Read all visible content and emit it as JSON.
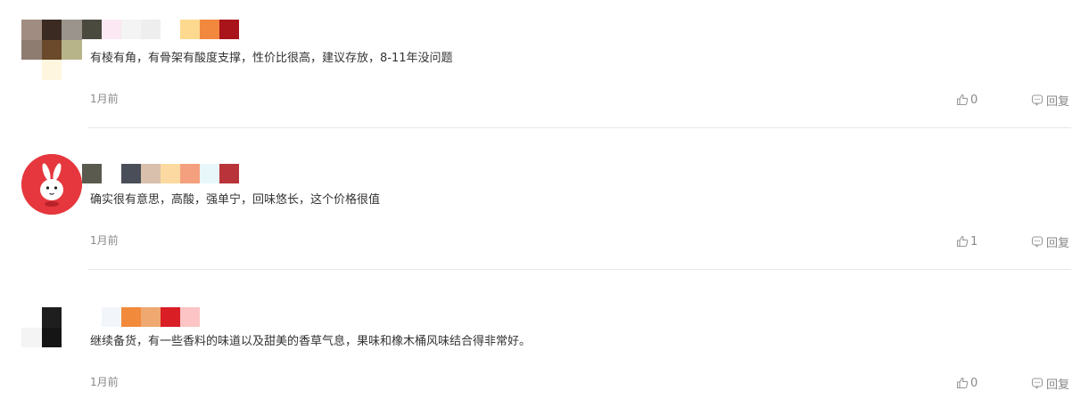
{
  "comments": [
    {
      "text": "有棱有角，有骨架有酸度支撑，性价比很高，建议存放，8-11年没问题",
      "time": "1月前",
      "likes": "0",
      "reply_label": "回复",
      "avatar_type": "pixelated",
      "avatar_colors": [
        "#a08c80",
        "#3a2a22",
        "#9a948c",
        "#8e7c70",
        "#6a4a2a",
        "#b8b48a",
        "#ffffff",
        "#fff6e0",
        "#ffffff"
      ],
      "name_colors": [
        "#4a4a3e",
        "#fbe8f2",
        "#f4f4f4",
        "#eeeeee",
        "#ffffff",
        "#fcd98e",
        "#f2873e",
        "#a8141a"
      ]
    },
    {
      "text": "确实很有意思，高酸，强单宁，回味悠长，这个价格很值",
      "time": "1月前",
      "likes": "1",
      "reply_label": "回复",
      "avatar_type": "bunny-icon",
      "avatar_colors": [
        "#e5373d",
        "#ffffff"
      ],
      "name_colors": [
        "#5a5a4e",
        "#ffffff",
        "#4a4e58",
        "#d8c0ac",
        "#fcd9a0",
        "#f4a07e",
        "#e8f8fa",
        "#b8343a"
      ]
    },
    {
      "text": "继续备货，有一些香料的味道以及甜美的香草气息，果味和橡木桶风味结合得非常好。",
      "time": "1月前",
      "likes": "0",
      "reply_label": "回复",
      "avatar_type": "pixelated",
      "avatar_colors": [
        "#ffffff",
        "#1e1e1e",
        "#ffffff",
        "#f4f4f4",
        "#151515",
        "#ffffff",
        "#ffffff",
        "#ffffff",
        "#ffffff"
      ],
      "name_colors": [
        "#ffffff",
        "#f2f6fa",
        "#f18a3a",
        "#eea870",
        "#d91e26",
        "#fcc4c4"
      ]
    }
  ]
}
